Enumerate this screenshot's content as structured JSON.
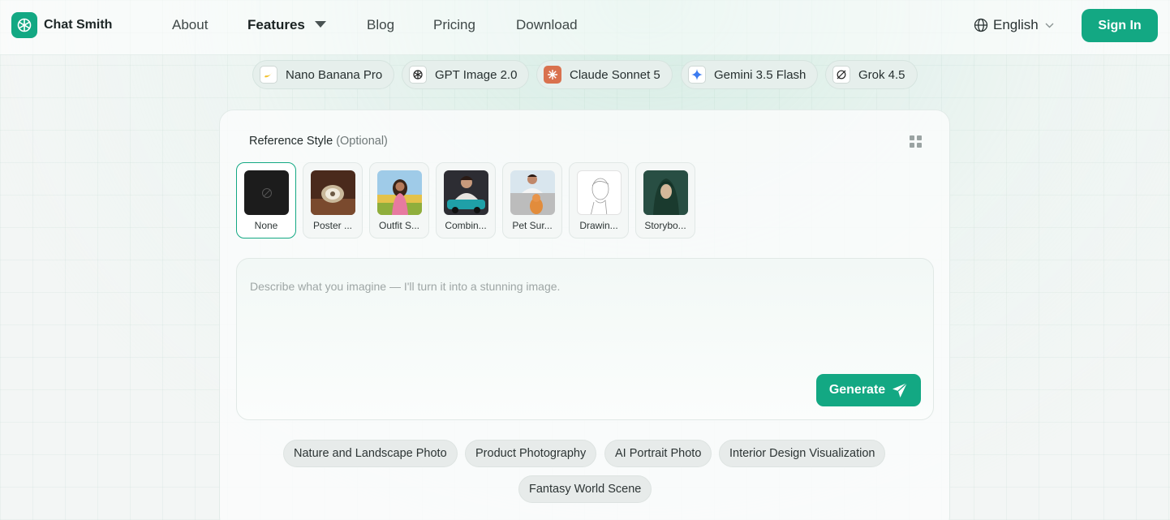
{
  "nav": {
    "brand": "Chat Smith",
    "links": [
      "About",
      "Features",
      "Blog",
      "Pricing",
      "Download"
    ],
    "language": "English",
    "signin_label": "Sign In"
  },
  "models": [
    {
      "label": "Nano Banana Pro",
      "icon": "banana-icon"
    },
    {
      "label": "GPT Image 2.0",
      "icon": "openai-icon"
    },
    {
      "label": "Claude Sonnet 5",
      "icon": "claude-icon"
    },
    {
      "label": "Gemini 3.5 Flash",
      "icon": "gemini-icon"
    },
    {
      "label": "Grok 4.5",
      "icon": "grok-icon"
    }
  ],
  "reference": {
    "title": "Reference Style",
    "optional": "(Optional)",
    "styles": [
      "None",
      "Poster ...",
      "Outfit S...",
      "Combin...",
      "Pet Sur...",
      "Drawin...",
      "Storybo..."
    ]
  },
  "prompt": {
    "placeholder": "Describe what you imagine — I'll turn it into a stunning image.",
    "generate_label": "Generate"
  },
  "suggestions": [
    "Nature and Landscape Photo",
    "Product Photography",
    "AI Portrait Photo",
    "Interior Design Visualization",
    "Fantasy World Scene"
  ],
  "colors": {
    "accent": "#13a883"
  }
}
